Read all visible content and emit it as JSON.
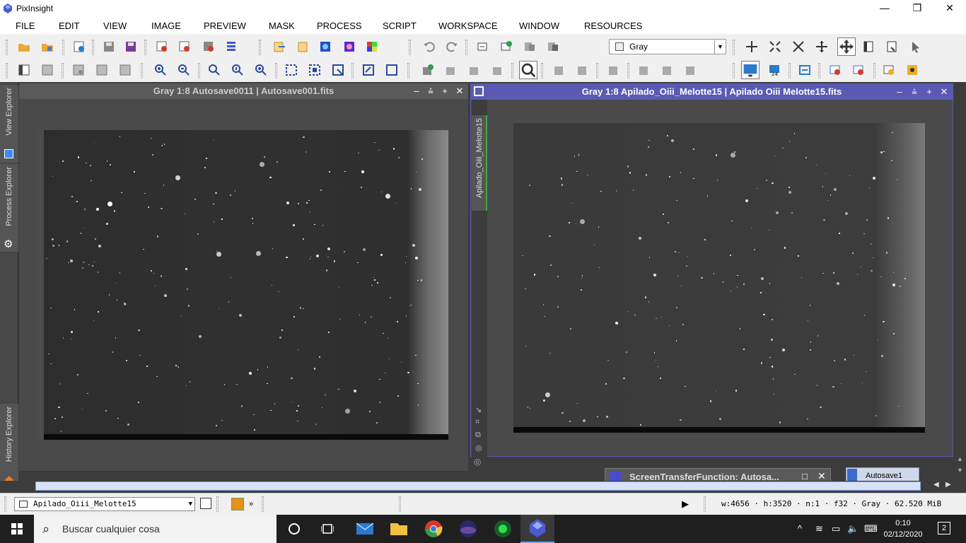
{
  "app": {
    "title": "PixInsight"
  },
  "menu": [
    "FILE",
    "EDIT",
    "VIEW",
    "IMAGE",
    "PREVIEW",
    "MASK",
    "PROCESS",
    "SCRIPT",
    "WORKSPACE",
    "WINDOW",
    "RESOURCES"
  ],
  "toolbar": {
    "color_space_value": "Gray"
  },
  "sidebar": {
    "tabs": [
      "View Explorer",
      "Process Explorer",
      "History Explorer"
    ]
  },
  "windows": {
    "left": {
      "title": "Gray 1:8 Autosave0011 | Autosave001.fits"
    },
    "right": {
      "title": "Gray 1:8 Apilado_Oiii_Melotte15 | Apilado Oiii Melotte15.fits",
      "side_tab": "Apilado_Oiii_Melotte15"
    }
  },
  "dock": {
    "stf_label": "ScreenTransferFunction: Autosa...",
    "icon_label": "Autosave1"
  },
  "status": {
    "view_selector": "Apilado_Oiii_Melotte15",
    "info": "w:4656 · h:3520 · n:1 · f32 · Gray · 62.520 MiB"
  },
  "taskbar": {
    "search_placeholder": "Buscar cualquier cosa",
    "time": "0:10",
    "date": "02/12/2020",
    "notif_count": "2"
  },
  "colors": {
    "active_header": "#5a5ab4",
    "workspace": "#3c3c3c",
    "taskbar": "#1f1f1f"
  }
}
